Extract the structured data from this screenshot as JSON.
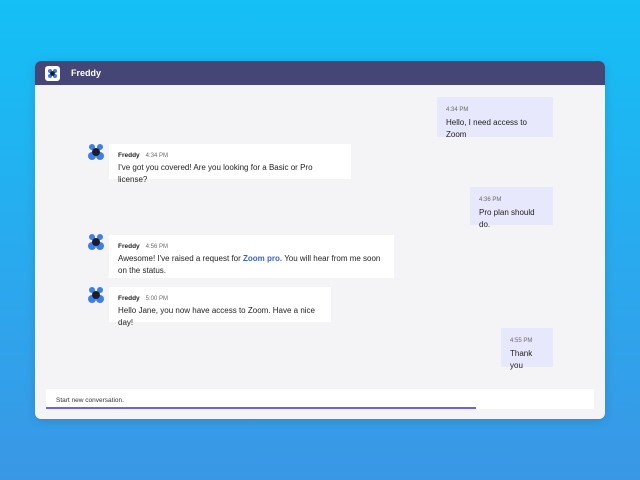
{
  "window": {
    "title": "Freddy"
  },
  "messages": [
    {
      "from": "user",
      "time": "4:34 PM",
      "text": "Hello, I need access to Zoom"
    },
    {
      "from": "bot",
      "sender": "Freddy",
      "time": "4:34 PM",
      "text": "I've got you covered! Are you looking for a Basic or Pro license?"
    },
    {
      "from": "user",
      "time": "4:36 PM",
      "text": "Pro plan should do."
    },
    {
      "from": "bot",
      "sender": "Freddy",
      "time": "4:56 PM",
      "text_before": "Awesome! I've raised a request for ",
      "link": "Zoom pro.",
      "text_after": " You will hear from me soon on the status."
    },
    {
      "from": "bot",
      "sender": "Freddy",
      "time": "5:00 PM",
      "text": "Hello Jane, you now have access to Zoom. Have a nice day!"
    },
    {
      "from": "user",
      "time": "4:55 PM",
      "text": "Thank you"
    }
  ],
  "composer": {
    "placeholder": "Start new conversation."
  },
  "colors": {
    "header": "#454675",
    "user_bubble": "#e7e8fb",
    "link": "#3a63d8",
    "accent": "#6b63e0"
  },
  "icons": {
    "logo": "freddy-logo-icon",
    "avatar": "freddy-avatar-icon"
  }
}
